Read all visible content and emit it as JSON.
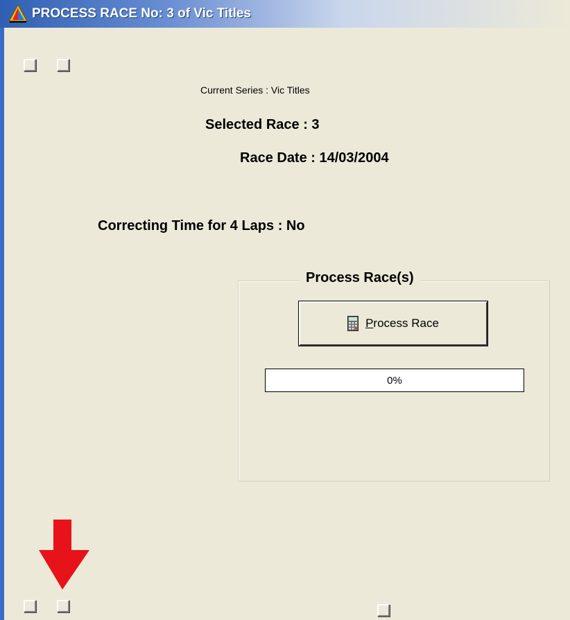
{
  "window": {
    "title": "PROCESS RACE No: 3 of Vic Titles",
    "app_icon": "sail-icon"
  },
  "info": {
    "current_series": "Current Series :  Vic Titles",
    "selected_race": "Selected Race :  3",
    "race_date": "Race Date :  14/03/2004",
    "correcting_time": "Correcting Time for 4 Laps :  No"
  },
  "process_group": {
    "title": "Process Race(s)",
    "button_label_mnemonic": "P",
    "button_label_rest": "rocess Race",
    "button_icon": "calculator-icon",
    "progress_text": "0%",
    "progress_value": 0
  },
  "annotation": {
    "arrow_icon": "red-down-arrow-icon",
    "arrow_color": "#e8121a"
  }
}
